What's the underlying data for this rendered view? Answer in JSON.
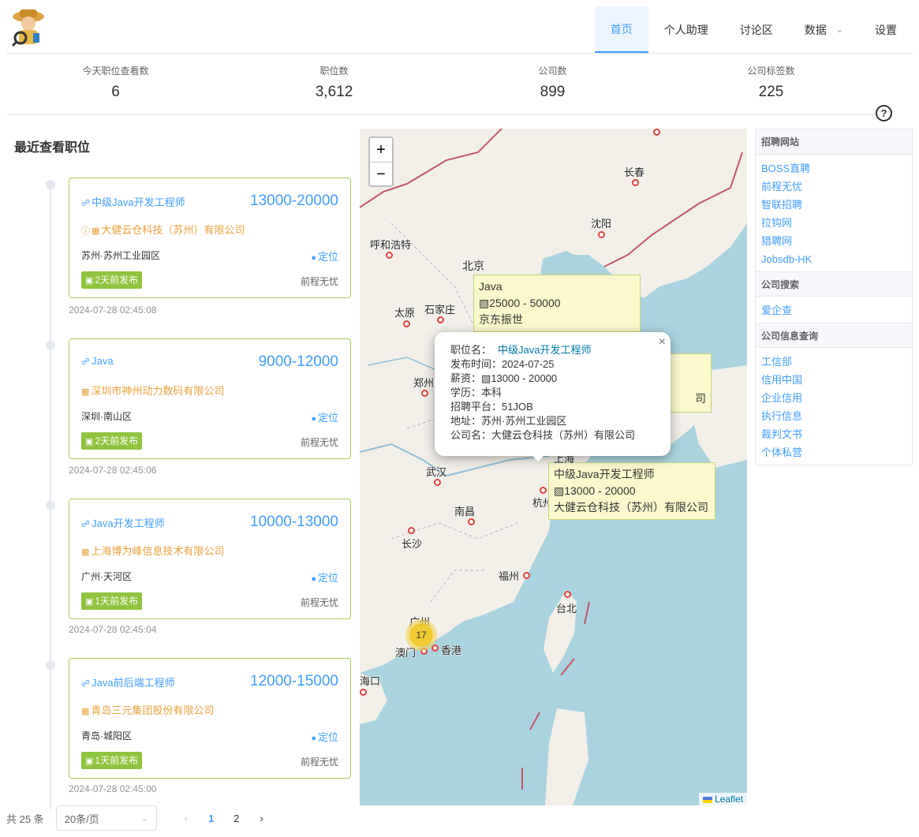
{
  "nav": {
    "items": [
      {
        "label": "首页",
        "active": true
      },
      {
        "label": "个人助理"
      },
      {
        "label": "讨论区"
      },
      {
        "label": "数据",
        "dropdown": true
      },
      {
        "label": "设置"
      }
    ]
  },
  "stats": [
    {
      "label": "今天职位查看数",
      "value": "6"
    },
    {
      "label": "职位数",
      "value": "3,612"
    },
    {
      "label": "公司数",
      "value": "899"
    },
    {
      "label": "公司标签数",
      "value": "225"
    }
  ],
  "help_label": "?",
  "recent": {
    "title": "最近查看职位",
    "locate_label": "定位",
    "jobs": [
      {
        "title": "中级Java开发工程师",
        "salary": "13000-20000",
        "company": "大健云仓科技（苏州）有限公司",
        "location": "苏州·苏州工业园区",
        "badge": "2天前发布",
        "source": "前程无忧",
        "time": "2024-07-28 02:45:08"
      },
      {
        "title": "Java",
        "salary": "9000-12000",
        "company": "深圳市神州动力数码有限公司",
        "location": "深圳·南山区",
        "badge": "2天前发布",
        "source": "前程无忧",
        "time": "2024-07-28 02:45:06"
      },
      {
        "title": "Java开发工程师",
        "salary": "10000-13000",
        "company": "上海博为峰信息技术有限公司",
        "location": "广州·天河区",
        "badge": "1天前发布",
        "source": "前程无忧",
        "time": "2024-07-28 02:45:04"
      },
      {
        "title": "Java前后端工程师",
        "salary": "12000-15000",
        "company": "青岛三元集团股份有限公司",
        "location": "青岛·城阳区",
        "badge": "1天前发布",
        "source": "前程无忧",
        "time": "2024-07-28 02:45:00"
      }
    ]
  },
  "pagination": {
    "total": "共 25 条",
    "page_size": "20条/页",
    "pages": [
      "1",
      "2"
    ],
    "current": "1"
  },
  "map": {
    "cities": [
      "长春",
      "沈阳",
      "呼和浩特",
      "北京",
      "太原",
      "石家庄",
      "郑州",
      "武汉",
      "南昌",
      "杭州",
      "长沙",
      "福州",
      "台北",
      "广州",
      "澳门",
      "香港",
      "海口",
      "上海"
    ],
    "tip_beijing": {
      "title": "Java",
      "salary": "25000 - 50000",
      "company": "京东振世"
    },
    "tip_suzhou": {
      "title": "中级Java开发工程师",
      "salary": "13000 - 20000",
      "company": "大健云仓科技（苏州）有限公司"
    },
    "tip_partial": "司",
    "popup": {
      "name_label": "职位名：",
      "name": "中级Java开发工程师",
      "date_label": "发布时间：",
      "date": "2024-07-25",
      "salary_label": "薪资：",
      "salary": "13000 - 20000",
      "edu_label": "学历：",
      "edu": "本科",
      "platform_label": "招聘平台：",
      "platform": "51JOB",
      "address_label": "地址：",
      "address": "苏州·苏州工业园区",
      "company_label": "公司名：",
      "company": "大健云仓科技（苏州）有限公司"
    },
    "cluster_count": "17",
    "attribution": "Leaflet",
    "zoom_in": "+",
    "zoom_out": "−"
  },
  "sidebar": {
    "sections": [
      {
        "title": "招聘网站",
        "links": [
          "BOSS直聘",
          "前程无忧",
          "智联招聘",
          "拉钩网",
          "猎聘网",
          "Jobsdb-HK"
        ]
      },
      {
        "title": "公司搜索",
        "links": [
          "爱企查"
        ]
      },
      {
        "title": "公司信息查询",
        "links": [
          "工信部",
          "信用中国",
          "企业信用",
          "执行信息",
          "裁判文书",
          "个体私营"
        ]
      }
    ]
  },
  "colors": {
    "accent": "#409eff",
    "card_border": "#a7cf58",
    "company": "#e6a23c",
    "badge": "#8fc43f"
  }
}
